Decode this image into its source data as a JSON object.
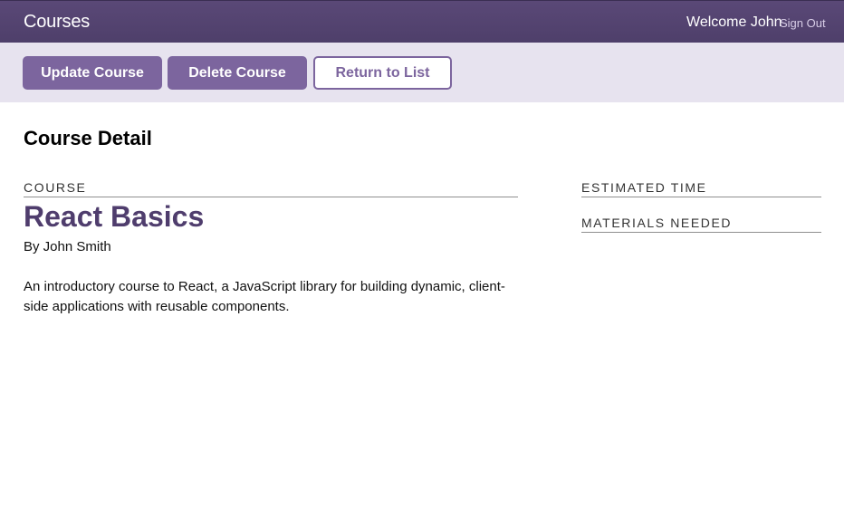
{
  "header": {
    "brand": "Courses",
    "welcome": "Welcome John",
    "sign_out": "Sign Out"
  },
  "actions": {
    "update": "Update Course",
    "delete": "Delete Course",
    "return": "Return to List"
  },
  "page": {
    "title": "Course Detail"
  },
  "course": {
    "label": "Course",
    "title": "React Basics",
    "author": "By John Smith",
    "description": "An introductory course to React, a JavaScript library for building dynamic, client-side applications with reusable components."
  },
  "sidebar": {
    "estimated_time_label": "Estimated Time",
    "materials_label": "Materials Needed"
  },
  "colors": {
    "header_bg": "#4e3f6a",
    "accent": "#7c659e",
    "title": "#4f3d6d",
    "actions_bg": "#e7e3ef"
  }
}
